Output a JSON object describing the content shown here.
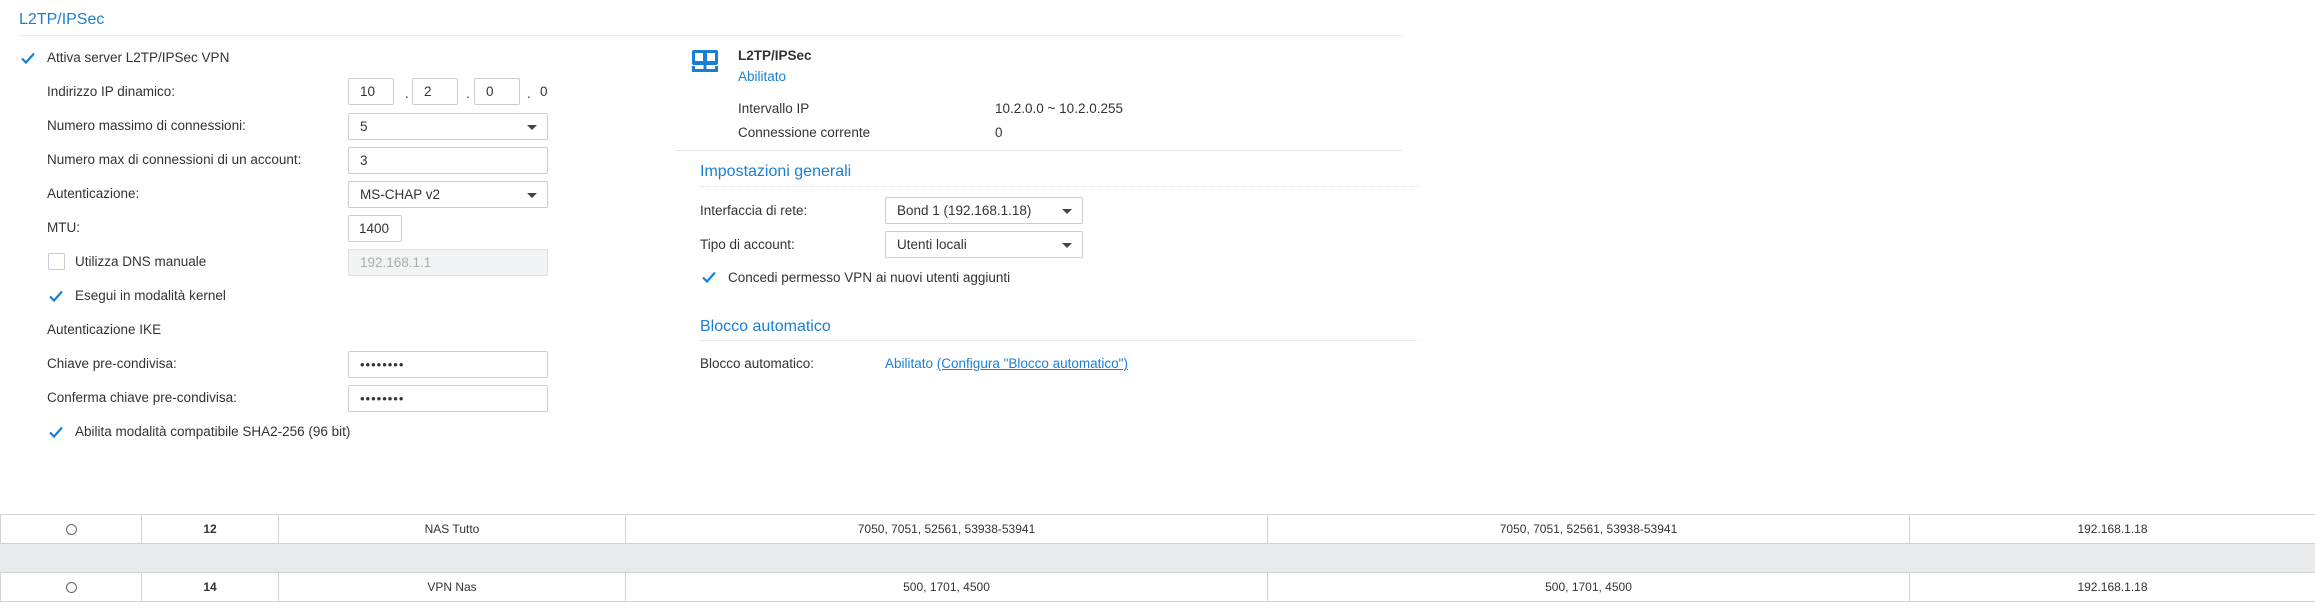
{
  "left": {
    "title": "L2TP/IPSec",
    "enable_label": "Attiva server L2TP/IPSec VPN",
    "ip_label": "Indirizzo IP dinamico:",
    "ip": [
      "10",
      "2",
      "0",
      "0"
    ],
    "ip_sep": ".",
    "max_conn_label": "Numero massimo di connessioni:",
    "max_conn_value": "5",
    "max_acc_label": "Numero max di connessioni di un account:",
    "max_acc_value": "3",
    "auth_label": "Autenticazione:",
    "auth_value": "MS-CHAP v2",
    "mtu_label": "MTU:",
    "mtu_value": "1400",
    "dns_label": "Utilizza DNS manuale",
    "dns_value": "192.168.1.1",
    "kernel_label": "Esegui in modalità kernel",
    "ike_label": "Autenticazione IKE",
    "psk_label": "Chiave pre-condivisa:",
    "psk_value": "••••••••",
    "psk_confirm_label": "Conferma chiave pre-condivisa:",
    "psk_confirm_value": "••••••••",
    "sha_label": "Abilita modalità compatibile SHA2-256 (96 bit)"
  },
  "status": {
    "icon": "server-network-icon",
    "title": "L2TP/IPSec",
    "state": "Abilitato",
    "range_label": "Intervallo IP",
    "range_value": "10.2.0.0 ~ 10.2.0.255",
    "conn_label": "Connessione corrente",
    "conn_value": "0"
  },
  "general": {
    "title": "Impostazioni generali",
    "iface_label": "Interfaccia di rete:",
    "iface_value": "Bond 1 (192.168.1.18)",
    "acc_type_label": "Tipo di account:",
    "acc_type_value": "Utenti locali",
    "grant_label": "Concedi permesso VPN ai nuovi utenti aggiunti"
  },
  "autoblock": {
    "title": "Blocco automatico",
    "label": "Blocco automatico:",
    "value": "Abilitato",
    "link": "(Configura \"Blocco automatico\")"
  },
  "rules_table": {
    "rows": [
      {
        "id": "12",
        "name": "NAS Tutto",
        "ports": "7050, 7051, 52561, 53938-53941",
        "ports2": "7050, 7051, 52561, 53938-53941",
        "ip": "192.168.1.18"
      },
      {
        "id": "14",
        "name": "VPN Nas",
        "ports": "500, 1701, 4500",
        "ports2": "500, 1701, 4500",
        "ip": "192.168.1.18"
      }
    ]
  },
  "colors": {
    "accent": "#1a7fd4",
    "text": "#333333",
    "border": "#c9ced5"
  }
}
